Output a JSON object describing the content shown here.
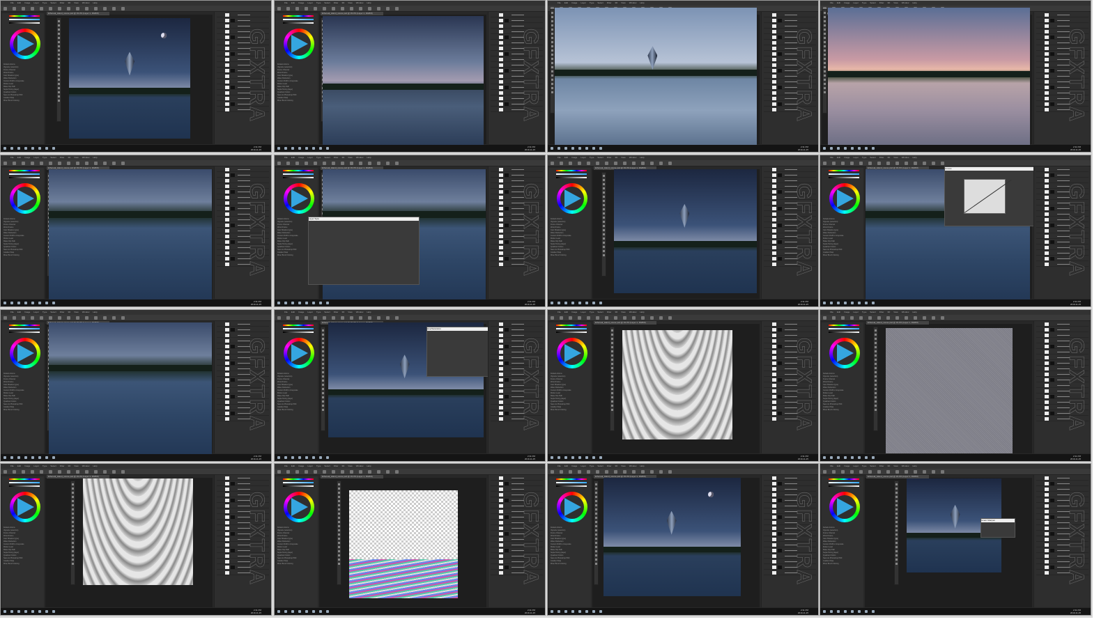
{
  "sheet": {
    "title": "Photoshop tutorial contact sheet",
    "watermark": "GFXTRA"
  },
  "app": {
    "menus": [
      "File",
      "Edit",
      "Image",
      "Layer",
      "Type",
      "Select",
      "Filter",
      "3D",
      "View",
      "Window",
      "Help"
    ],
    "document_tab": "Ethereal_island_scene.psd @ 33.3% (Layer 1, RGB/8)",
    "actions": [
      "Default Actions",
      "Vignette (selection)",
      "Frame Channel",
      "Wood Frame",
      "Cast Shadow (type)",
      "Water Reflection",
      "Custom RGB to Grayscale",
      "Molten Lead",
      "Make Clip Path",
      "Sepia Toning (layer)",
      "Quadrant Colors",
      "Save As Photoshop PDF",
      "Gradient Map",
      "Mixer Brush Cloning"
    ],
    "clock": [
      "2:31 PM",
      "2019-11-25"
    ]
  },
  "frames": [
    {
      "scene": "night",
      "crystal": true,
      "moon": true,
      "left": true
    },
    {
      "scene": "dusk",
      "left": true
    },
    {
      "scene": "bright",
      "crystal": true,
      "left": false
    },
    {
      "scene": "sunset",
      "left": false
    },
    {
      "scene": "blue",
      "left": true
    },
    {
      "scene": "blue",
      "left": true,
      "dialog": "Layer Style"
    },
    {
      "scene": "night",
      "crystal": true,
      "left": true
    },
    {
      "scene": "blue",
      "left": true,
      "dialog": "Curves"
    },
    {
      "scene": "blue",
      "left": true
    },
    {
      "scene": "night",
      "crystal": true,
      "left": true,
      "dialog": "Hue/Saturation"
    },
    {
      "scene": "sand",
      "left": true
    },
    {
      "scene": "noise",
      "left": true
    },
    {
      "scene": "sand",
      "left": true
    },
    {
      "scene": "trans",
      "left": true
    },
    {
      "scene": "night",
      "crystal": true,
      "moon": true,
      "left": true
    },
    {
      "scene": "night",
      "crystal": true,
      "left": true,
      "dialog": "Smart Sharpen"
    }
  ]
}
